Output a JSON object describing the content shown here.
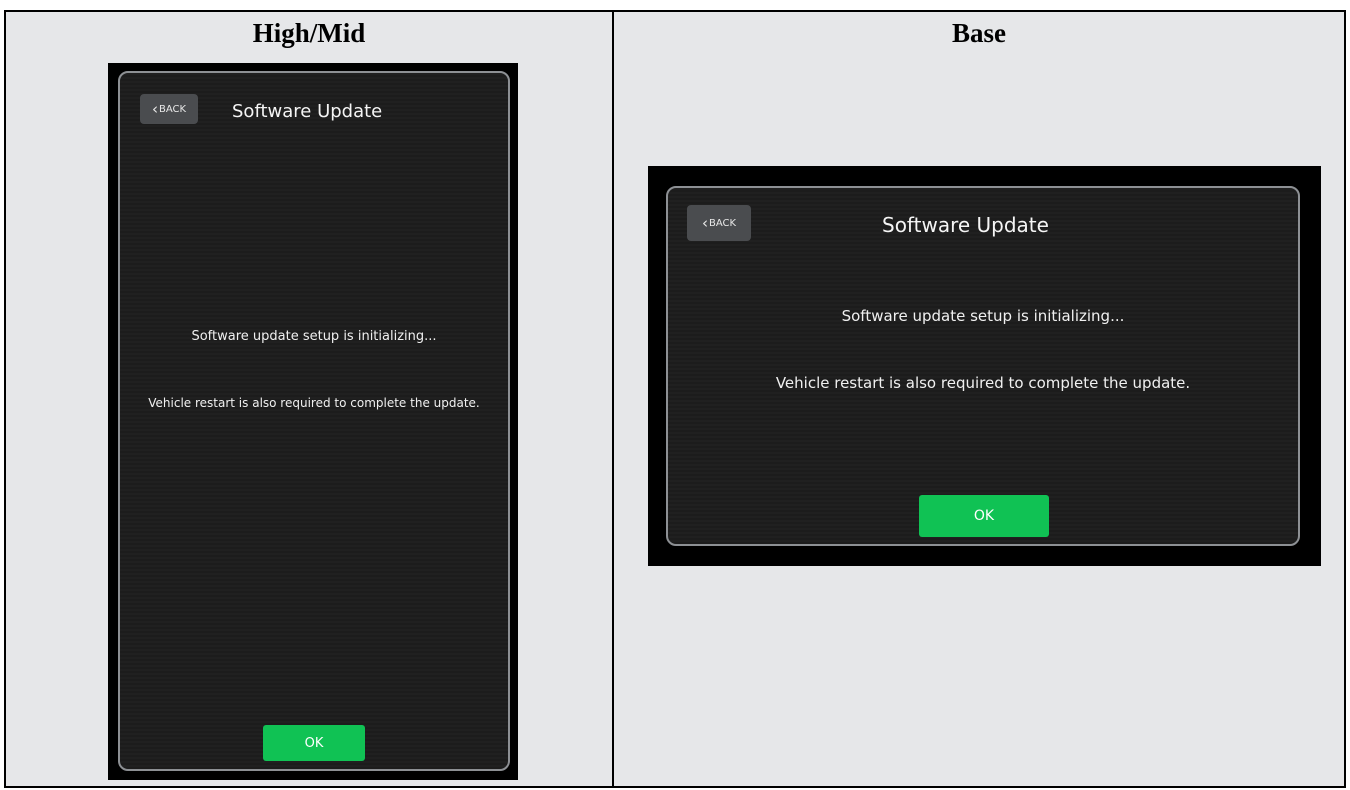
{
  "columns": {
    "left_title": "High/Mid",
    "right_title": "Base"
  },
  "screen": {
    "back_label": "BACK",
    "title": "Software Update",
    "message1": "Software update setup is initializing...",
    "message2": "Vehicle restart is also required to complete the update.",
    "ok_label": "OK"
  },
  "colors": {
    "ok_button": "#10c254",
    "screen_bg": "#1c1c1c",
    "back_button": "#4a4c4f"
  }
}
